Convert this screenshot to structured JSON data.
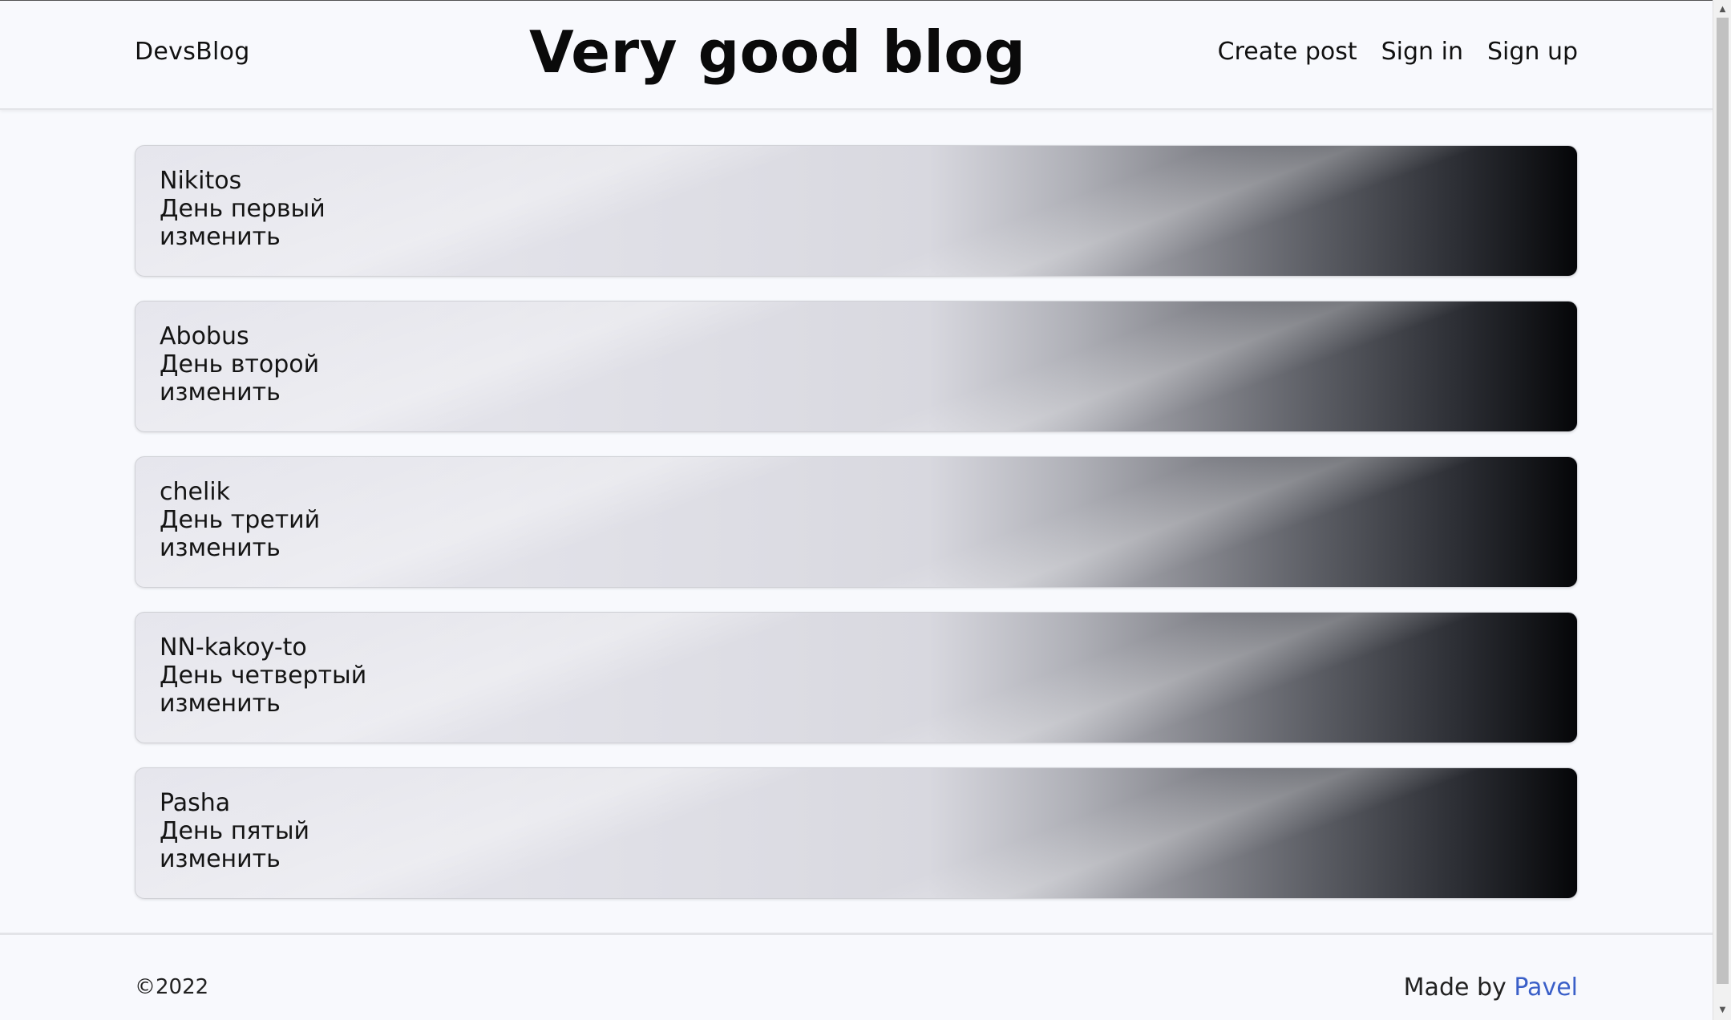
{
  "header": {
    "brand": "DevsBlog",
    "title": "Very good blog",
    "nav": {
      "create_post": "Create post",
      "sign_in": "Sign in",
      "sign_up": "Sign up"
    }
  },
  "posts": [
    {
      "author": "Nikitos",
      "title": "День первый",
      "edit": "изменить"
    },
    {
      "author": "Abobus",
      "title": "День второй",
      "edit": "изменить"
    },
    {
      "author": "chelik",
      "title": "День третий",
      "edit": "изменить"
    },
    {
      "author": "NN-kakoy-to",
      "title": "День четвертый",
      "edit": "изменить"
    },
    {
      "author": "Pasha",
      "title": "День пятый",
      "edit": "изменить"
    }
  ],
  "footer": {
    "copyright": "©2022",
    "made_by_prefix": "Made by ",
    "made_by_name": "Pavel",
    "link_color": "#3a5fc8"
  },
  "scrollbar": {
    "up_icon": "scroll-up-arrow-icon",
    "down_icon": "scroll-down-arrow-icon"
  }
}
